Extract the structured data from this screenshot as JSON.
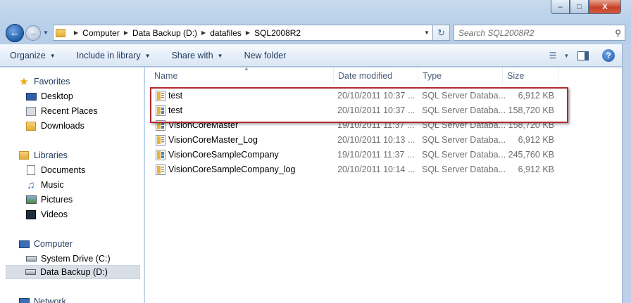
{
  "window": {
    "caption_buttons": {
      "minimize": "–",
      "maximize": "□",
      "close": "X"
    }
  },
  "navigation": {
    "back_icon": "back-arrow-icon",
    "breadcrumbs": [
      "Computer",
      "Data Backup (D:)",
      "datafiles",
      "SQL2008R2"
    ],
    "search_placeholder": "Search SQL2008R2"
  },
  "toolbar": {
    "organize": "Organize",
    "include_in_library": "Include in library",
    "share_with": "Share with",
    "new_folder": "New folder"
  },
  "sidebar": {
    "favorites": {
      "label": "Favorites",
      "items": [
        "Desktop",
        "Recent Places",
        "Downloads"
      ]
    },
    "libraries": {
      "label": "Libraries",
      "items": [
        "Documents",
        "Music",
        "Pictures",
        "Videos"
      ]
    },
    "computer": {
      "label": "Computer",
      "items": [
        "System Drive (C:)",
        "Data Backup (D:)"
      ]
    },
    "network": {
      "label": "Network"
    },
    "selected": "Data Backup (D:)"
  },
  "columns": {
    "name": "Name",
    "date": "Date modified",
    "type": "Type",
    "size": "Size"
  },
  "files": [
    {
      "name": "test",
      "date": "20/10/2011 10:37 ...",
      "type": "SQL Server Databa...",
      "size": "6,912 KB",
      "kind": "log"
    },
    {
      "name": "test",
      "date": "20/10/2011 10:37 ...",
      "type": "SQL Server Databa...",
      "size": "158,720 KB",
      "kind": "data"
    },
    {
      "name": "VisionCoreMaster",
      "date": "19/10/2011 11:37 ...",
      "type": "SQL Server Databa...",
      "size": "158,720 KB",
      "kind": "data"
    },
    {
      "name": "VisionCoreMaster_Log",
      "date": "20/10/2011 10:13 ...",
      "type": "SQL Server Databa...",
      "size": "6,912 KB",
      "kind": "log"
    },
    {
      "name": "VisionCoreSampleCompany",
      "date": "19/10/2011 11:37 ...",
      "type": "SQL Server Databa...",
      "size": "245,760 KB",
      "kind": "data"
    },
    {
      "name": "VisionCoreSampleCompany_log",
      "date": "20/10/2011 10:14 ...",
      "type": "SQL Server Databa...",
      "size": "6,912 KB",
      "kind": "log"
    }
  ],
  "colors": {
    "highlight_box": "#b2272f"
  }
}
